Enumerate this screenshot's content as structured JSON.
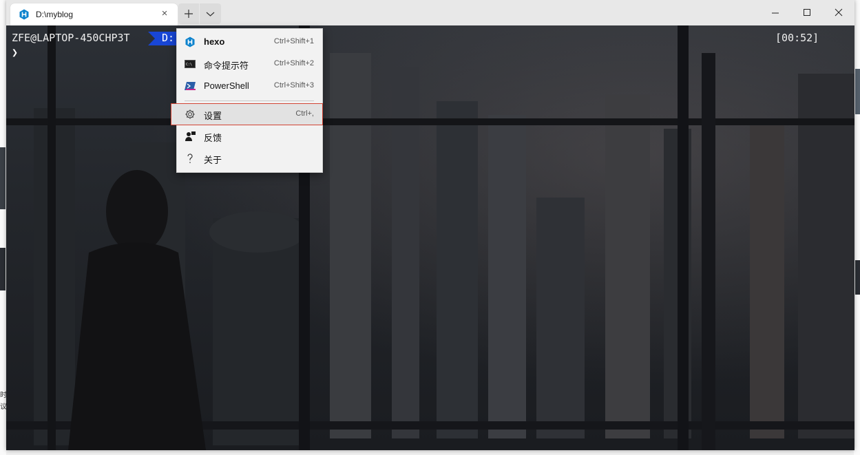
{
  "tab": {
    "title": "D:\\myblog",
    "icon": "hexo-icon"
  },
  "titlebar": {
    "new_tab_glyph": "+",
    "close_tab_glyph": "×"
  },
  "terminal": {
    "user_host": "ZFE@LAPTOP-450CHP3T",
    "path_segment": "D:",
    "prompt_char": "❯",
    "clock": "[00:52]"
  },
  "menu": {
    "items": [
      {
        "label": "hexo",
        "shortcut": "Ctrl+Shift+1",
        "icon": "hexo-icon"
      },
      {
        "label": "命令提示符",
        "shortcut": "Ctrl+Shift+2",
        "icon": "cmd-icon"
      },
      {
        "label": "PowerShell",
        "shortcut": "Ctrl+Shift+3",
        "icon": "powershell-icon"
      },
      {
        "label": "设置",
        "shortcut": "Ctrl+,",
        "icon": "gear-icon"
      },
      {
        "label": "反馈",
        "shortcut": "",
        "icon": "feedback-icon"
      },
      {
        "label": "关于",
        "shortcut": "",
        "icon": "question-icon"
      }
    ]
  },
  "background_left": {
    "char1": "时",
    "char2": "议"
  },
  "colors": {
    "accent": "#1846d6",
    "highlight_border": "#d24434",
    "hexo": "#0e83cd"
  }
}
